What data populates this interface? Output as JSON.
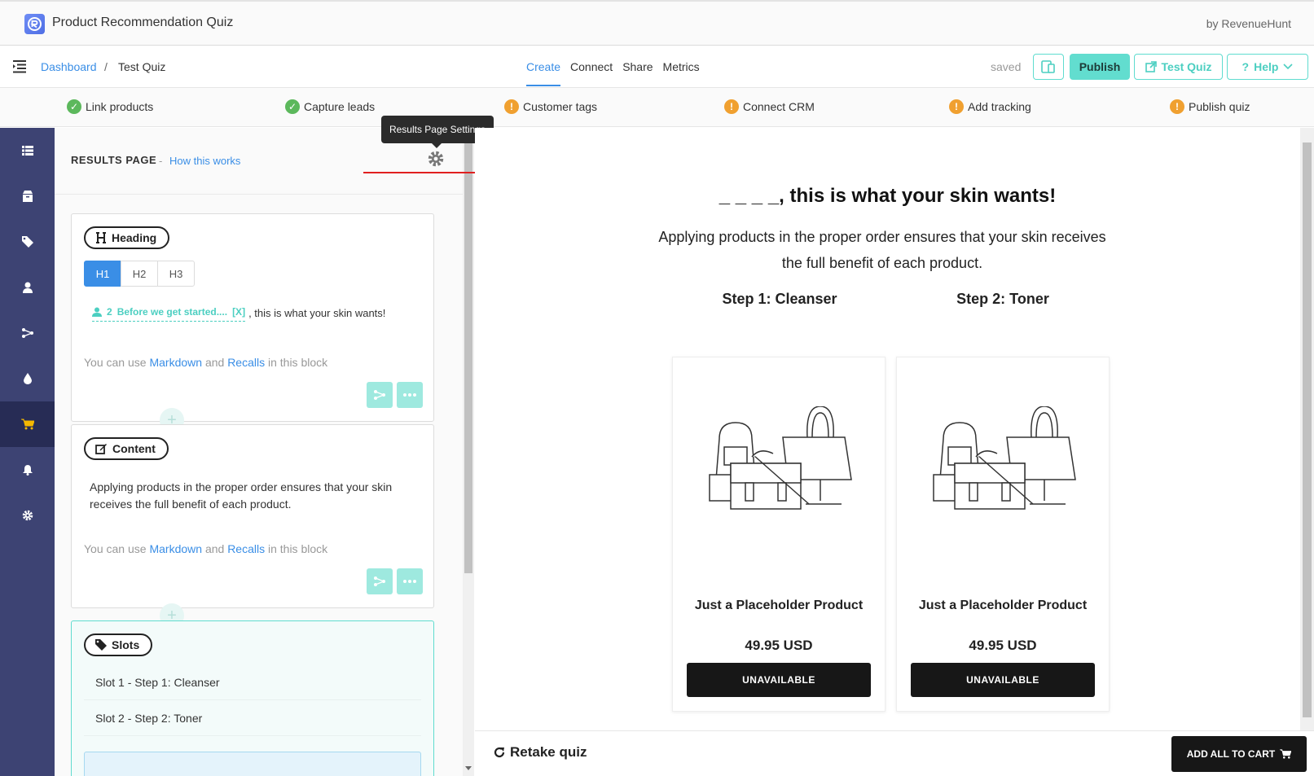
{
  "app": {
    "title": "Product Recommendation Quiz",
    "by": "by RevenueHunt"
  },
  "nav": {
    "breadcrumb_root": "Dashboard",
    "breadcrumb_sep": "/",
    "breadcrumb_current": "Test Quiz",
    "tabs": [
      {
        "label": "Create",
        "active": true
      },
      {
        "label": "Connect",
        "active": false
      },
      {
        "label": "Share",
        "active": false
      },
      {
        "label": "Metrics",
        "active": false
      }
    ],
    "saved_label": "saved",
    "publish_label": "Publish",
    "test_label": "Test Quiz",
    "help_label": "Help"
  },
  "checklist": [
    {
      "label": "Link products",
      "status": "done"
    },
    {
      "label": "Capture leads",
      "status": "done"
    },
    {
      "label": "Customer tags",
      "status": "warning"
    },
    {
      "label": "Connect CRM",
      "status": "warning"
    },
    {
      "label": "Add tracking",
      "status": "warning"
    },
    {
      "label": "Publish quiz",
      "status": "warning"
    }
  ],
  "rail_icons": [
    "list-icon",
    "box-icon",
    "tag-icon",
    "user-icon",
    "branch-icon",
    "drop-icon",
    "cart-icon",
    "bell-icon",
    "gear-icon"
  ],
  "rail_active": "cart-icon",
  "editor": {
    "title": "RESULTS PAGE",
    "dash": "-",
    "how_link": "How this works",
    "tooltip": "Results Page Settings",
    "heading_block": {
      "pill": "Heading",
      "levels": [
        "H1",
        "H2",
        "H3"
      ],
      "selected_level": "H1",
      "recall_number": "2",
      "recall_text": "Before we get started....",
      "recall_remove": "[X]",
      "recall_suffix": ", this is what your skin wants!"
    },
    "hint": {
      "prefix": "You can use",
      "markdown": "Markdown",
      "and": "and",
      "recalls": "Recalls",
      "suffix": "in this block"
    },
    "content_block": {
      "pill": "Content",
      "text": "Applying products in the proper order ensures that your skin receives the full benefit of each product."
    },
    "slots_block": {
      "pill": "Slots",
      "slots": [
        "Slot 1 - Step 1: Cleanser",
        "Slot 2 - Step 2: Toner"
      ]
    }
  },
  "preview": {
    "title": "_ _ _ _, this is what your skin wants!",
    "description": "Applying products in the proper order ensures that your skin receives the full benefit of each product.",
    "steps": [
      "Step 1: Cleanser",
      "Step 2: Toner"
    ],
    "products": [
      {
        "name": "Just a Placeholder Product",
        "price": "49.95 USD",
        "button": "UNAVAILABLE"
      },
      {
        "name": "Just a Placeholder Product",
        "price": "49.95 USD",
        "button": "UNAVAILABLE"
      }
    ],
    "retake": "Retake quiz",
    "add_all": "ADD ALL TO CART"
  },
  "colors": {
    "accent": "#3a8ee6",
    "teal": "#62ddcf",
    "rail": "#3d4373",
    "annotation": "#e02020"
  }
}
